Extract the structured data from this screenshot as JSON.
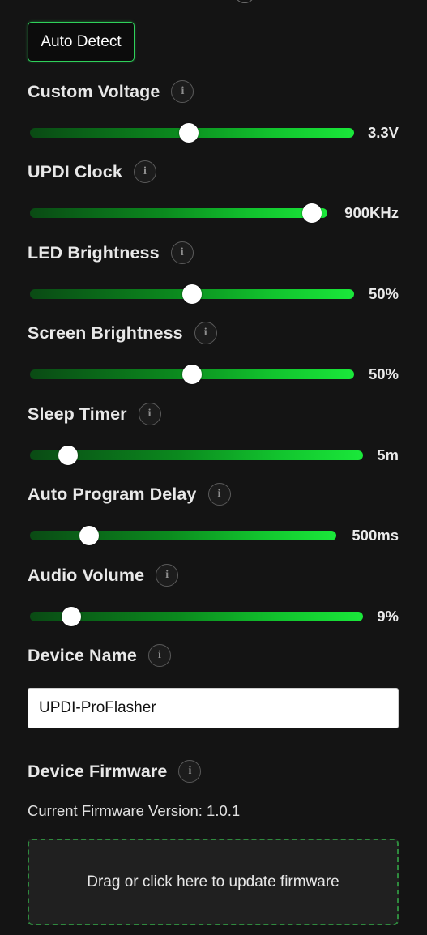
{
  "auto_detect_button": "Auto Detect",
  "info_icon_glyph": "i",
  "settings": [
    {
      "label": "Custom Voltage",
      "value": "3.3V",
      "fraction": 0.49
    },
    {
      "label": "UPDI Clock",
      "value": "900KHz",
      "fraction": 1.0
    },
    {
      "label": "LED Brightness",
      "value": "50%",
      "fraction": 0.5
    },
    {
      "label": "Screen Brightness",
      "value": "50%",
      "fraction": 0.5
    },
    {
      "label": "Sleep Timer",
      "value": "5m",
      "fraction": 0.1
    },
    {
      "label": "Auto Program Delay",
      "value": "500ms",
      "fraction": 0.18
    },
    {
      "label": "Audio Volume",
      "value": "9%",
      "fraction": 0.11
    }
  ],
  "device_name": {
    "label": "Device Name",
    "value": "UPDI-ProFlasher"
  },
  "device_firmware": {
    "label": "Device Firmware",
    "current_version_text": "Current Firmware Version: 1.0.1",
    "dropzone_text": "Drag or click here to update firmware"
  },
  "colors": {
    "accent": "#2fd05a",
    "track_end": "#1ae83a",
    "background": "#141414"
  }
}
